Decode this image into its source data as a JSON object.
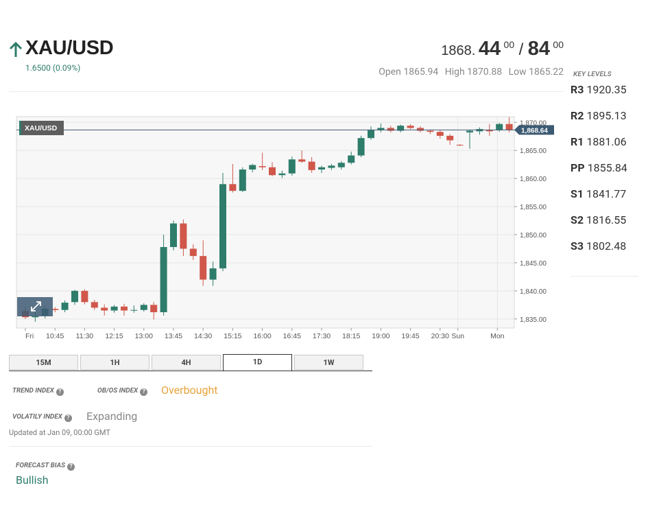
{
  "header": {
    "symbol": "XAU/USD",
    "change": "1.6500 (0.09%)",
    "price_prefix": "1868.",
    "bid_big": "44",
    "bid_sup": "00",
    "separator": "/",
    "ask_big": "84",
    "ask_sup": "00",
    "open": "Open 1865.94",
    "high": "High 1870.88",
    "low": "Low 1865.22",
    "direction_icon": "arrow-up-icon"
  },
  "key_levels": {
    "title": "KEY LEVELS",
    "items": [
      {
        "name": "R3",
        "value": "1920.35"
      },
      {
        "name": "R2",
        "value": "1895.13"
      },
      {
        "name": "R1",
        "value": "1881.06"
      },
      {
        "name": "PP",
        "value": "1855.84"
      },
      {
        "name": "S1",
        "value": "1841.77"
      },
      {
        "name": "S2",
        "value": "1816.55"
      },
      {
        "name": "S3",
        "value": "1802.48"
      }
    ]
  },
  "chart_data": {
    "type": "candlestick",
    "symbol_label": "XAU/USD",
    "current_price_label": "1,868.64",
    "current_price": 1868.64,
    "ylim": [
      1834,
      1871.5
    ],
    "y_ticks": [
      1835,
      1840,
      1845,
      1850,
      1855,
      1860,
      1865,
      1870
    ],
    "y_tick_labels": [
      "1,835.00",
      "1,840.00",
      "1,845.00",
      "1,850.00",
      "1,855.00",
      "1,860.00",
      "1,865.00",
      "1,870.00"
    ],
    "x_ticks": [
      {
        "label": "Fri",
        "index": 0
      },
      {
        "label": "10:45",
        "index": 3
      },
      {
        "label": "11:30",
        "index": 6
      },
      {
        "label": "12:15",
        "index": 9
      },
      {
        "label": "13:00",
        "index": 12
      },
      {
        "label": "13:45",
        "index": 15
      },
      {
        "label": "14:30",
        "index": 18
      },
      {
        "label": "15:15",
        "index": 21
      },
      {
        "label": "16:00",
        "index": 24
      },
      {
        "label": "16:45",
        "index": 27
      },
      {
        "label": "17:30",
        "index": 30
      },
      {
        "label": "18:15",
        "index": 33
      },
      {
        "label": "19:00",
        "index": 36
      },
      {
        "label": "19:45",
        "index": 39
      },
      {
        "label": "20:30",
        "index": 42
      },
      {
        "label": "Sun",
        "index": 43.8
      },
      {
        "label": "Mon",
        "index": 47.8
      }
    ],
    "candles": [
      [
        1836.4,
        1837.2,
        1835.0,
        1835.3
      ],
      [
        1835.3,
        1836.5,
        1834.5,
        1835.5
      ],
      [
        1835.6,
        1837.3,
        1835.1,
        1836.8
      ],
      [
        1836.8,
        1837.1,
        1836.2,
        1836.6
      ],
      [
        1836.6,
        1838.3,
        1836.2,
        1837.9
      ],
      [
        1838.0,
        1840.2,
        1837.5,
        1840.0
      ],
      [
        1840.0,
        1840.3,
        1837.6,
        1838.0
      ],
      [
        1838.0,
        1838.4,
        1836.6,
        1837.0
      ],
      [
        1837.0,
        1837.6,
        1835.6,
        1836.5
      ],
      [
        1836.5,
        1837.5,
        1836.1,
        1837.2
      ],
      [
        1837.2,
        1837.7,
        1835.6,
        1836.5
      ],
      [
        1836.6,
        1837.4,
        1836.1,
        1836.6
      ],
      [
        1836.6,
        1837.8,
        1836.3,
        1837.5
      ],
      [
        1837.5,
        1838.0,
        1834.9,
        1836.2
      ],
      [
        1836.2,
        1850.0,
        1835.6,
        1847.8
      ],
      [
        1847.8,
        1852.5,
        1847.2,
        1852.0
      ],
      [
        1852.0,
        1852.7,
        1846.2,
        1847.5
      ],
      [
        1847.5,
        1848.3,
        1845.5,
        1846.2
      ],
      [
        1846.2,
        1849.0,
        1840.9,
        1842.0
      ],
      [
        1842.0,
        1845.2,
        1840.9,
        1844.0
      ],
      [
        1844.0,
        1861.0,
        1843.5,
        1859.0
      ],
      [
        1859.0,
        1862.6,
        1857.5,
        1857.8
      ],
      [
        1857.8,
        1862.0,
        1857.6,
        1861.6
      ],
      [
        1861.6,
        1862.6,
        1861.1,
        1862.4
      ],
      [
        1862.2,
        1864.6,
        1861.5,
        1862.0
      ],
      [
        1862.0,
        1862.9,
        1860.4,
        1860.6
      ],
      [
        1860.6,
        1861.4,
        1860.1,
        1860.9
      ],
      [
        1860.9,
        1863.9,
        1860.5,
        1863.4
      ],
      [
        1863.4,
        1865.0,
        1862.8,
        1863.0
      ],
      [
        1863.0,
        1863.8,
        1861.0,
        1861.5
      ],
      [
        1861.6,
        1862.3,
        1861.0,
        1862.0
      ],
      [
        1861.9,
        1862.6,
        1861.5,
        1862.3
      ],
      [
        1862.0,
        1863.1,
        1861.6,
        1862.8
      ],
      [
        1862.8,
        1864.8,
        1862.5,
        1864.1
      ],
      [
        1864.1,
        1867.6,
        1863.8,
        1867.2
      ],
      [
        1867.2,
        1869.3,
        1866.9,
        1868.6
      ],
      [
        1868.6,
        1869.8,
        1868.2,
        1869.0
      ],
      [
        1869.0,
        1869.4,
        1868.2,
        1868.5
      ],
      [
        1868.5,
        1869.6,
        1868.2,
        1869.4
      ],
      [
        1869.4,
        1869.7,
        1868.8,
        1869.0
      ],
      [
        1869.0,
        1869.3,
        1868.2,
        1868.5
      ],
      [
        1868.5,
        1868.7,
        1867.9,
        1868.3
      ],
      [
        1868.3,
        1868.6,
        1867.1,
        1867.6
      ],
      [
        1867.6,
        1867.9,
        1866.0,
        1866.8
      ],
      [
        1866.0,
        1866.1,
        1865.8,
        1865.9
      ],
      [
        1868.2,
        1868.7,
        1865.3,
        1868.5
      ],
      [
        1868.4,
        1869.1,
        1867.8,
        1868.8
      ],
      [
        1868.6,
        1869.7,
        1867.6,
        1868.4
      ],
      [
        1868.6,
        1869.9,
        1868.3,
        1869.7
      ],
      [
        1869.7,
        1870.9,
        1868.2,
        1868.64
      ]
    ],
    "colors": {
      "up": "#2e7d6b",
      "down": "#d0574a",
      "price_line": "#3d5a73",
      "label_bg": "#3d5a73"
    }
  },
  "timeframe_tabs": {
    "items": [
      "15M",
      "1H",
      "4H",
      "1D",
      "1W"
    ],
    "active": "1D"
  },
  "indices": {
    "trend_label": "TREND INDEX",
    "trend_value": "",
    "obos_label": "OB/OS INDEX",
    "obos_value": "Overbought",
    "volatility_label": "VOLATILY INDEX",
    "volatility_value": "Expanding",
    "updated": "Updated at Jan 09, 00:00 GMT",
    "forecast_label": "FORECAST BIAS",
    "forecast_value": "Bullish",
    "colors": {
      "overbought": "#e8a33b",
      "bullish": "#2e7d6b",
      "neutral": "#888888"
    }
  }
}
